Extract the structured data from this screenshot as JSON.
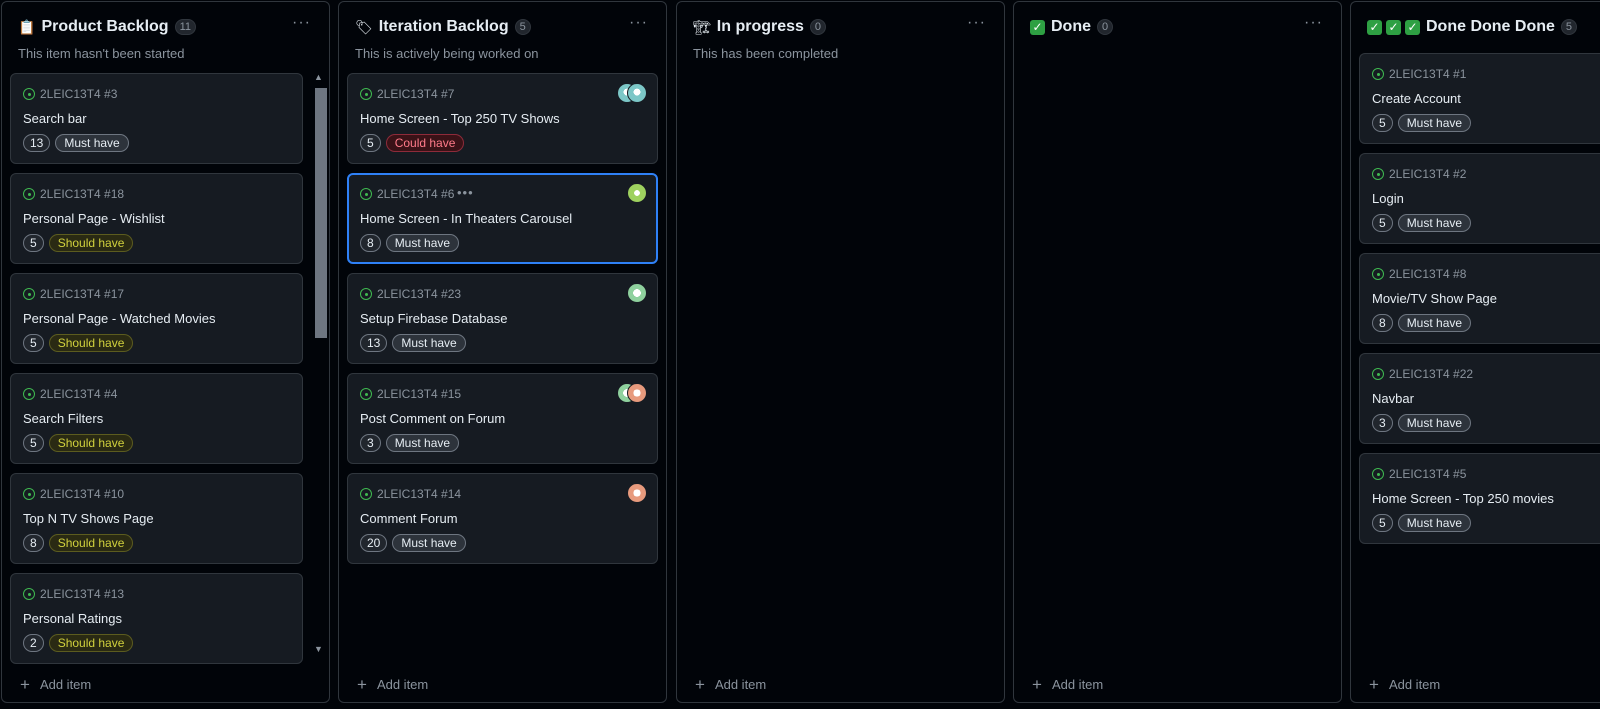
{
  "columns": [
    {
      "title": "Product Backlog",
      "count": "11",
      "emoji": "📋",
      "description": "This item hasn't been started",
      "add_label": "Add item",
      "cards": [
        {
          "ref": "2LEIC13T4 #3",
          "title": "Search bar",
          "estimate": "13",
          "priority": "Must have"
        },
        {
          "ref": "2LEIC13T4 #18",
          "title": "Personal Page - Wishlist",
          "estimate": "5",
          "priority": "Should have"
        },
        {
          "ref": "2LEIC13T4 #17",
          "title": "Personal Page - Watched Movies",
          "estimate": "5",
          "priority": "Should have"
        },
        {
          "ref": "2LEIC13T4 #4",
          "title": "Search Filters",
          "estimate": "5",
          "priority": "Should have"
        },
        {
          "ref": "2LEIC13T4 #10",
          "title": "Top N TV Shows Page",
          "estimate": "8",
          "priority": "Should have"
        },
        {
          "ref": "2LEIC13T4 #13",
          "title": "Personal Ratings",
          "estimate": "2",
          "priority": "Should have"
        }
      ]
    },
    {
      "title": "Iteration Backlog",
      "count": "5",
      "emoji": "🏷",
      "description": "This is actively being worked on",
      "add_label": "Add item",
      "cards": [
        {
          "ref": "2LEIC13T4 #7",
          "title": "Home Screen - Top 250 TV Shows",
          "estimate": "5",
          "priority": "Could have"
        },
        {
          "ref": "2LEIC13T4 #6",
          "title": "Home Screen - In Theaters Carousel",
          "estimate": "8",
          "priority": "Must have",
          "menu": "•••"
        },
        {
          "ref": "2LEIC13T4 #23",
          "title": "Setup Firebase Database",
          "estimate": "13",
          "priority": "Must have"
        },
        {
          "ref": "2LEIC13T4 #15",
          "title": "Post Comment on Forum",
          "estimate": "3",
          "priority": "Must have"
        },
        {
          "ref": "2LEIC13T4 #14",
          "title": "Comment Forum",
          "estimate": "20",
          "priority": "Must have"
        }
      ]
    },
    {
      "title": "In progress",
      "count": "0",
      "emoji": "🏗",
      "description": "This has been completed",
      "add_label": "Add item",
      "cards": []
    },
    {
      "title": "Done",
      "count": "0",
      "emoji": "✅",
      "description": "",
      "add_label": "Add item",
      "cards": []
    },
    {
      "title": "Done Done Done",
      "count": "5",
      "emoji": "✅ ✅ ✅",
      "description": "",
      "add_label": "Add item",
      "cards": [
        {
          "ref": "2LEIC13T4 #1",
          "title": "Create Account",
          "estimate": "5",
          "priority": "Must have"
        },
        {
          "ref": "2LEIC13T4 #2",
          "title": "Login",
          "estimate": "5",
          "priority": "Must have"
        },
        {
          "ref": "2LEIC13T4 #8",
          "title": "Movie/TV Show Page",
          "estimate": "8",
          "priority": "Must have"
        },
        {
          "ref": "2LEIC13T4 #22",
          "title": "Navbar",
          "estimate": "3",
          "priority": "Must have"
        },
        {
          "ref": "2LEIC13T4 #5",
          "title": "Home Screen - Top 250 movies",
          "estimate": "5",
          "priority": "Must have"
        }
      ]
    }
  ],
  "column_menu": "···",
  "colors": {
    "accent": "#2f81f7",
    "status_open": "#3fb950",
    "must": "#6e7681",
    "should": "#d1d13d",
    "could": "#ff7b8a"
  }
}
